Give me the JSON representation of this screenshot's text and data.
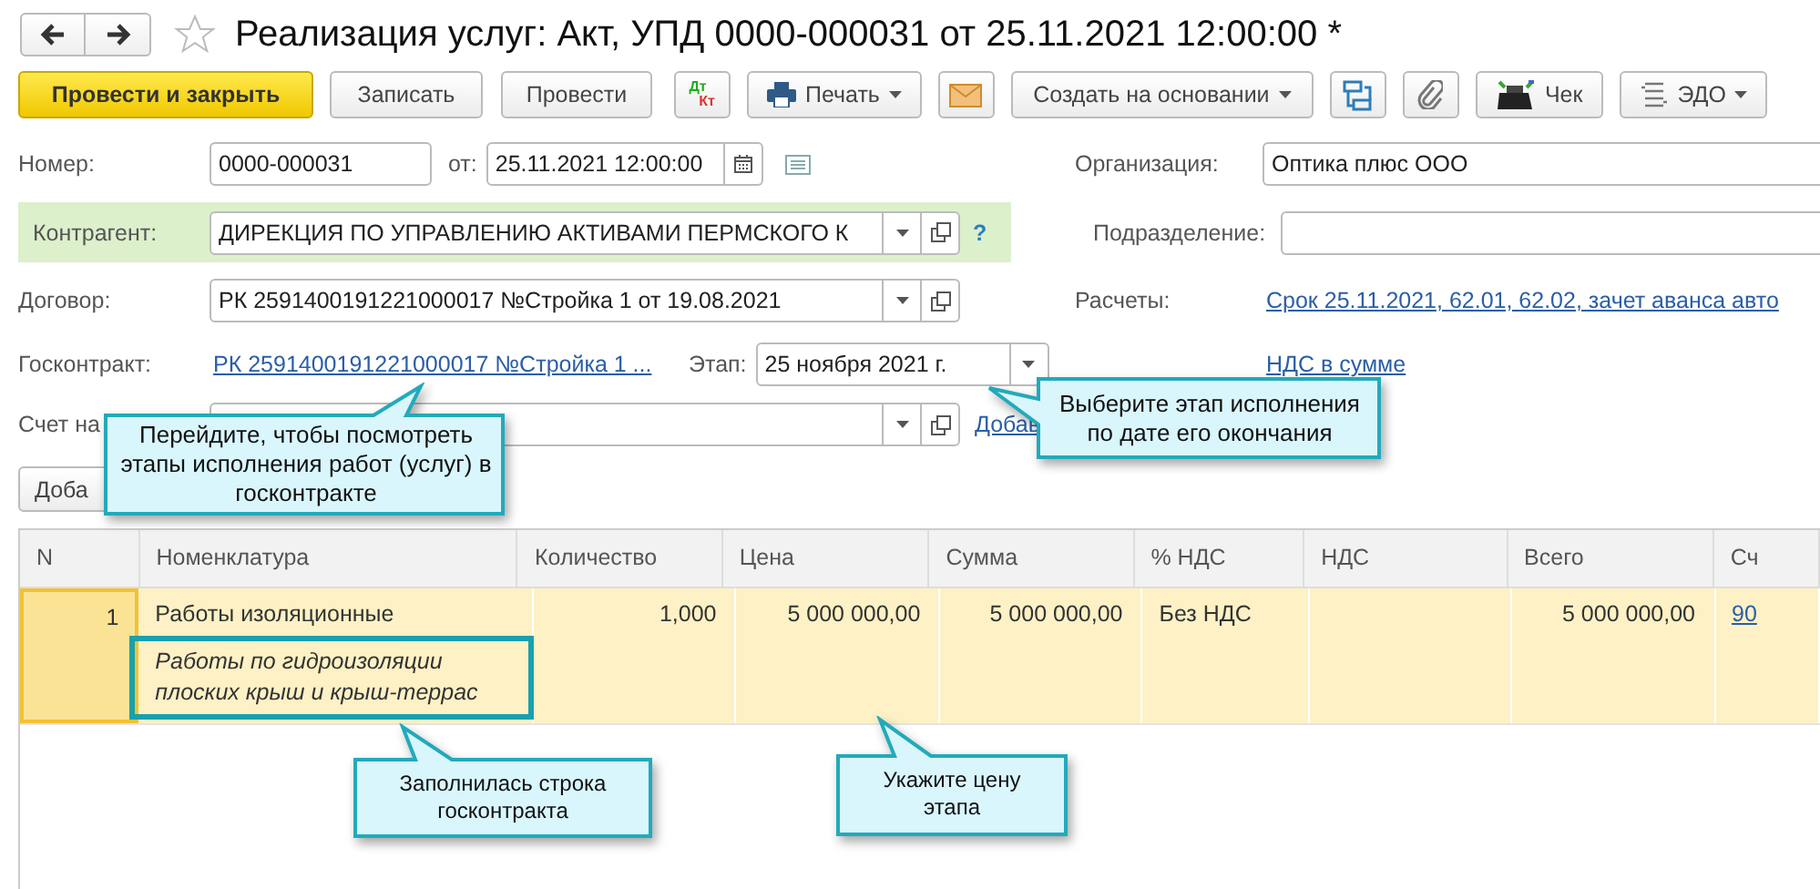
{
  "window": {
    "title": "Реализация услуг: Акт, УПД 0000-000031 от 25.11.2021 12:00:00 *",
    "favorite": false
  },
  "toolbar": [
    {
      "kind": "primary",
      "label": "Провести и закрыть"
    },
    {
      "kind": "button",
      "label": "Записать"
    },
    {
      "kind": "button",
      "label": "Провести"
    },
    {
      "kind": "dtkt",
      "label": "Дт",
      "label_2": "Кт"
    },
    {
      "kind": "print",
      "label": "Печать"
    },
    {
      "kind": "mail"
    },
    {
      "kind": "menu",
      "label": "Создать на основании"
    },
    {
      "kind": "structure"
    },
    {
      "kind": "clip"
    },
    {
      "kind": "check",
      "label": "Чек"
    },
    {
      "kind": "edo",
      "label": "ЭДО"
    }
  ],
  "number": {
    "label": "Номер:",
    "value": "0000-000031",
    "date_label": "от:",
    "date": "25.11.2021 12:00:00"
  },
  "organization": {
    "label": "Организация:",
    "value": "Оптика плюс ООО"
  },
  "counterparty": {
    "label": "Контрагент:",
    "value": "ДИРЕКЦИЯ ПО УПРАВЛЕНИЮ АКТИВАМИ ПЕРМСКОГО К",
    "help": "?"
  },
  "department": {
    "label": "Подразделение:"
  },
  "contract": {
    "label": "Договор:",
    "value": "РК 2591400191221000017 №Стройка 1 от 19.08.2021"
  },
  "settlements": {
    "label": "Расчеты:",
    "link": "Срок 25.11.2021, 62.01, 62.02, зачет аванса авто"
  },
  "gov_contract": {
    "label": "Госконтракт:",
    "link": "РК 2591400191221000017 №Стройка 1 ...",
    "stage_label": "Этап:",
    "stage": "25 ноября 2021 г."
  },
  "vat_link": "НДС в сумме",
  "invoice": {
    "label": "Счет на",
    "link": "Добав"
  },
  "add_button": "Доба",
  "table": {
    "columns": [
      "N",
      "Номенклатура",
      "Количество",
      "Цена",
      "Сумма",
      "% НДС",
      "НДС",
      "Всего",
      "Сч"
    ],
    "rows": [
      {
        "selected": true,
        "n": "1",
        "name": "Работы изоляционные",
        "description": "Работы по гидроизоляции плоских крыш и крыш-террас",
        "quantity": "1,000",
        "price": "5 000 000,00",
        "sum": "5 000 000,00",
        "vat_rate": "Без НДС",
        "total": "5 000 000,00",
        "account": "90"
      }
    ]
  },
  "callouts": [
    {
      "text": "Перейдите, чтобы посмотреть этапы исполнения работ (услуг) в госконтракте"
    },
    {
      "text": "Выберите этап исполнения по дате его окончания"
    },
    {
      "text": "Заполнилась строка госконтракта"
    },
    {
      "text": "Укажите цену этапа"
    }
  ]
}
